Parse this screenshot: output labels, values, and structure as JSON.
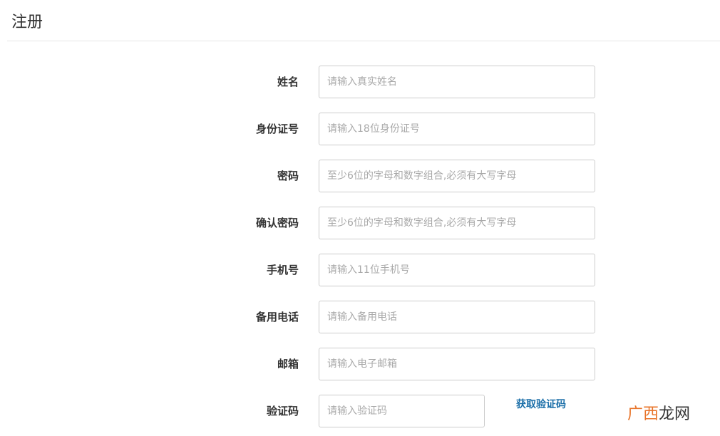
{
  "page": {
    "title": "注册"
  },
  "form": {
    "fields": [
      {
        "label": "姓名",
        "placeholder": "请输入真实姓名",
        "value": ""
      },
      {
        "label": "身份证号",
        "placeholder": "请输入18位身份证号",
        "value": ""
      },
      {
        "label": "密码",
        "placeholder": "至少6位的字母和数字组合,必须有大写字母",
        "value": ""
      },
      {
        "label": "确认密码",
        "placeholder": "至少6位的字母和数字组合,必须有大写字母",
        "value": ""
      },
      {
        "label": "手机号",
        "placeholder": "请输入11位手机号",
        "value": ""
      },
      {
        "label": "备用电话",
        "placeholder": "请输入备用电话",
        "value": ""
      },
      {
        "label": "邮箱",
        "placeholder": "请输入电子邮箱",
        "value": ""
      },
      {
        "label": "验证码",
        "placeholder": "请输入验证码",
        "value": ""
      }
    ],
    "get_code_label": "获取验证码"
  },
  "watermark": {
    "part1": "广西",
    "part2": "龙网",
    "colors": {
      "part1": "#e8742a",
      "part2": "#333333"
    }
  },
  "colors": {
    "link": "#1a6ea8",
    "border": "#cccccc",
    "placeholder": "#a9a9a9"
  }
}
